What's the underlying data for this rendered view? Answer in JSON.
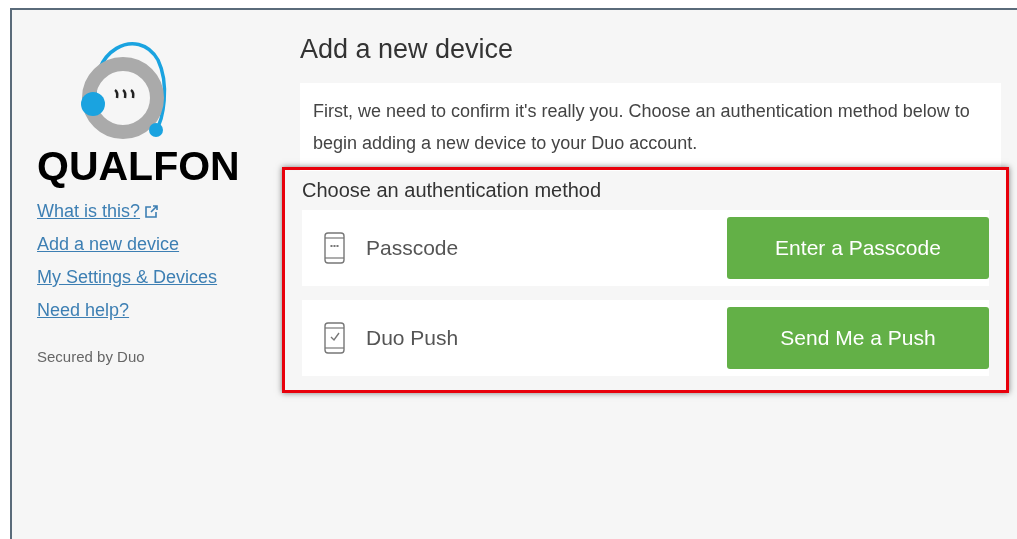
{
  "brand": {
    "name": "QUALFON"
  },
  "sidebar": {
    "links": [
      {
        "label": "What is this?",
        "external": true
      },
      {
        "label": "Add a new device",
        "external": false
      },
      {
        "label": "My Settings & Devices",
        "external": false
      },
      {
        "label": "Need help?",
        "external": false
      }
    ],
    "footer": "Secured by Duo"
  },
  "main": {
    "title": "Add a new device",
    "intro": "First, we need to confirm it's really you. Choose an authentication method below to begin adding a new device to your Duo account.",
    "methods_heading": "Choose an authentication method",
    "methods": [
      {
        "kind": "passcode",
        "label": "Passcode",
        "button": "Enter a Passcode"
      },
      {
        "kind": "push",
        "label": "Duo Push",
        "button": "Send Me a Push"
      }
    ]
  }
}
